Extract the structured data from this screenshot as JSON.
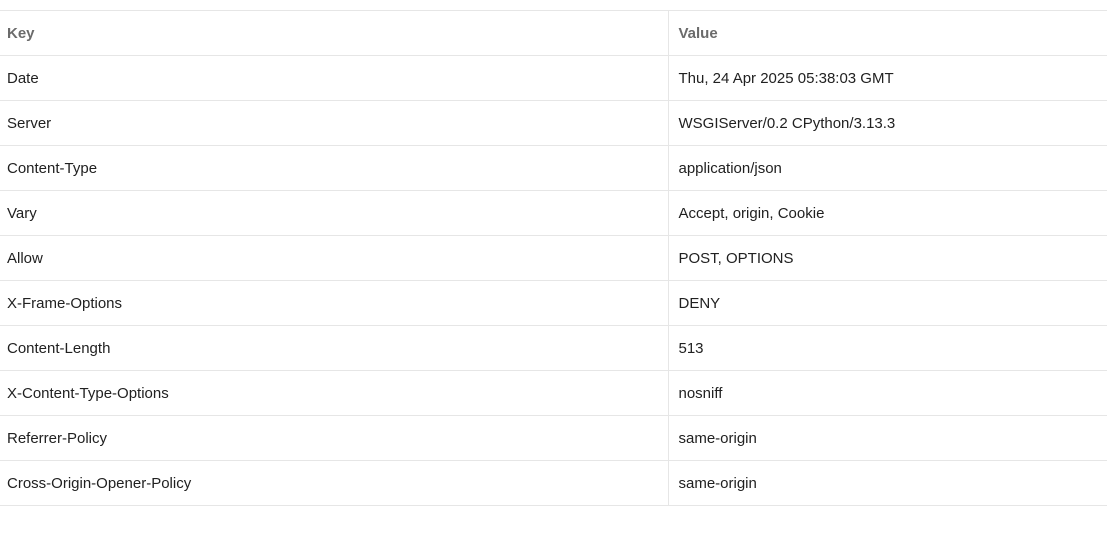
{
  "headers_table": {
    "columns": {
      "key": "Key",
      "value": "Value"
    },
    "rows": [
      {
        "key": "Date",
        "value": "Thu, 24 Apr 2025 05:38:03 GMT"
      },
      {
        "key": "Server",
        "value": "WSGIServer/0.2 CPython/3.13.3"
      },
      {
        "key": "Content-Type",
        "value": "application/json"
      },
      {
        "key": "Vary",
        "value": "Accept, origin, Cookie"
      },
      {
        "key": "Allow",
        "value": "POST, OPTIONS"
      },
      {
        "key": "X-Frame-Options",
        "value": "DENY"
      },
      {
        "key": "Content-Length",
        "value": "513"
      },
      {
        "key": "X-Content-Type-Options",
        "value": "nosniff"
      },
      {
        "key": "Referrer-Policy",
        "value": "same-origin"
      },
      {
        "key": "Cross-Origin-Opener-Policy",
        "value": "same-origin"
      }
    ]
  }
}
